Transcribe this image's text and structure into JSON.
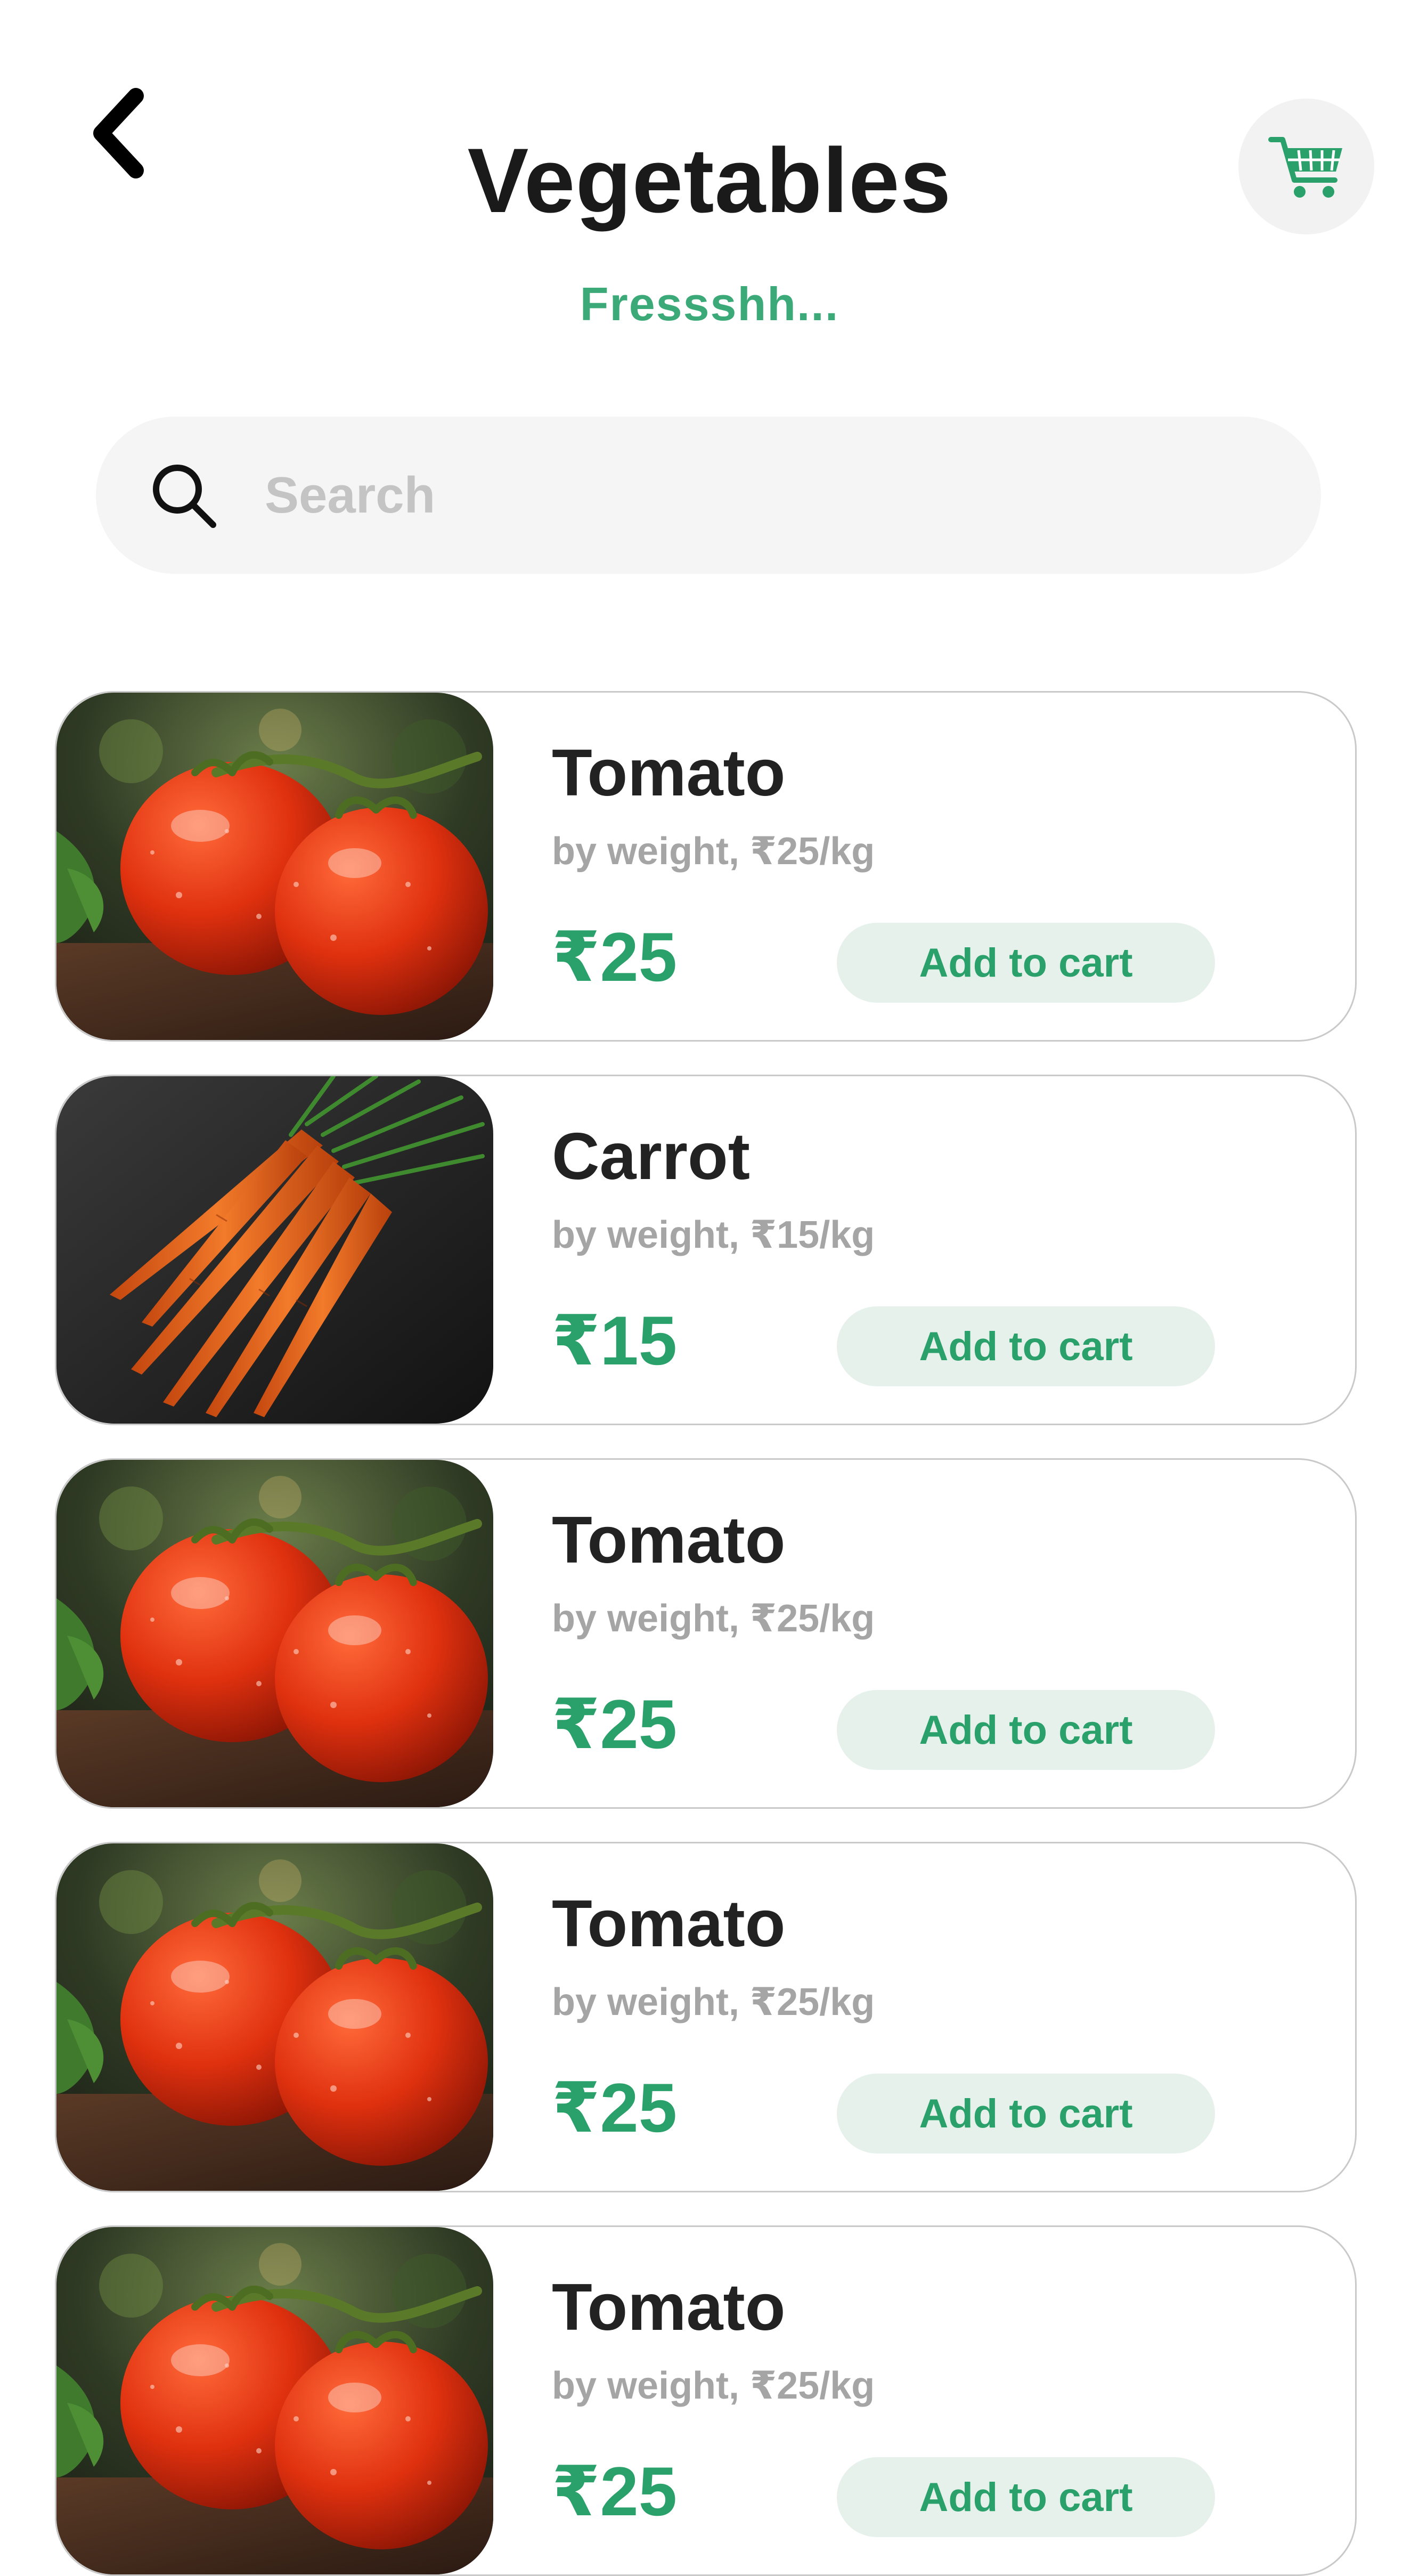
{
  "header": {
    "title": "Vegetables",
    "subtitle": "Fressshh...",
    "back_icon": "chevron-left-icon",
    "cart_icon": "shopping-cart-icon"
  },
  "search": {
    "placeholder": "Search",
    "value": ""
  },
  "colors": {
    "accent": "#2aa06a",
    "button_bg": "#e7f1ec",
    "muted": "#a5a5a5"
  },
  "products": [
    {
      "name": "Tomato",
      "meta": "by weight, ₹25/kg",
      "price": "₹25",
      "button": "Add to cart",
      "image": "tomato"
    },
    {
      "name": "Carrot",
      "meta": "by weight, ₹15/kg",
      "price": "₹15",
      "button": "Add to cart",
      "image": "carrot"
    },
    {
      "name": "Tomato",
      "meta": "by weight, ₹25/kg",
      "price": "₹25",
      "button": "Add to cart",
      "image": "tomato"
    },
    {
      "name": "Tomato",
      "meta": "by weight, ₹25/kg",
      "price": "₹25",
      "button": "Add to cart",
      "image": "tomato"
    },
    {
      "name": "Tomato",
      "meta": "by weight, ₹25/kg",
      "price": "₹25",
      "button": "Add to cart",
      "image": "tomato"
    }
  ]
}
